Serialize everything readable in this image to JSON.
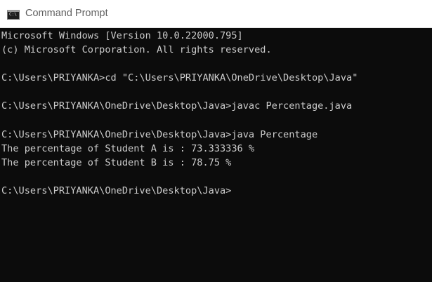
{
  "window": {
    "title": "Command Prompt",
    "icon": "cmd-console-icon",
    "icon_prompt": "C:\\"
  },
  "console": {
    "lines": [
      "Microsoft Windows [Version 10.0.22000.795]",
      "(c) Microsoft Corporation. All rights reserved.",
      "",
      "C:\\Users\\PRIYANKA>cd \"C:\\Users\\PRIYANKA\\OneDrive\\Desktop\\Java\"",
      "",
      "C:\\Users\\PRIYANKA\\OneDrive\\Desktop\\Java>javac Percentage.java",
      "",
      "C:\\Users\\PRIYANKA\\OneDrive\\Desktop\\Java>java Percentage",
      "The percentage of Student A is : 73.333336 %",
      "The percentage of Student B is : 78.75 %",
      "",
      "C:\\Users\\PRIYANKA\\OneDrive\\Desktop\\Java>"
    ]
  },
  "colors": {
    "background": "#0c0c0c",
    "text": "#cccccc",
    "titlebar": "#ffffff",
    "title_text": "#5f5f5f"
  }
}
